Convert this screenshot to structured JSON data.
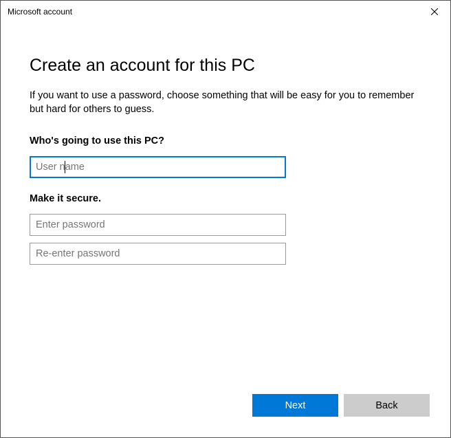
{
  "window": {
    "title": "Microsoft account"
  },
  "page": {
    "heading": "Create an account for this PC",
    "description": "If you want to use a password, choose something that will be easy for you to remember but hard for others to guess."
  },
  "form": {
    "username_section_label": "Who's going to use this PC?",
    "username_placeholder": "User name",
    "username_value": "",
    "secure_section_label": "Make it secure.",
    "password_placeholder": "Enter password",
    "password_value": "",
    "confirm_placeholder": "Re-enter password",
    "confirm_value": ""
  },
  "buttons": {
    "next": "Next",
    "back": "Back"
  },
  "colors": {
    "accent": "#0078d7"
  }
}
